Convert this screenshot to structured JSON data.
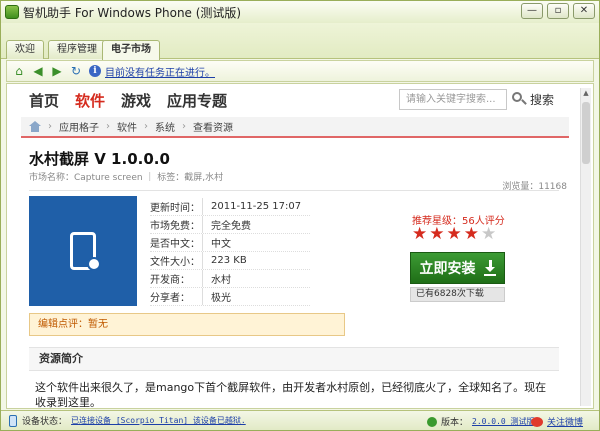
{
  "window": {
    "title": "智机助手 For Windows Phone (测试版)",
    "buttons": [
      "—",
      "▫",
      "✕"
    ]
  },
  "tabs": [
    {
      "label": "欢迎",
      "active": false
    },
    {
      "label": "程序管理",
      "active": false
    },
    {
      "label": "电子市场",
      "active": true
    }
  ],
  "toolbar": {
    "status_text": "目前没有任务正在进行。",
    "info_icon": "i"
  },
  "nav": {
    "items": [
      {
        "label": "首页",
        "active": false
      },
      {
        "label": "软件",
        "active": true
      },
      {
        "label": "游戏",
        "active": false
      },
      {
        "label": "应用专题",
        "active": false
      }
    ],
    "search_placeholder": "请输入关键字搜索...",
    "search_button": "搜索"
  },
  "breadcrumb": {
    "items": [
      "应用格子",
      "软件",
      "系统",
      "查看资源"
    ],
    "separator": "›"
  },
  "app": {
    "title": "水村截屏 V 1.0.0.0",
    "meta": "市场名称：Capture screen  ｜  标签：截屏,水村",
    "views": "浏览量：11168",
    "details": [
      {
        "label": "更新时间：",
        "value": "2011-11-25 17:07"
      },
      {
        "label": "市场免费：",
        "value": "完全免费"
      },
      {
        "label": "是否中文：",
        "value": "中文"
      },
      {
        "label": "文件大小：",
        "value": "223 KB"
      },
      {
        "label": "开发商：",
        "value": "水村"
      },
      {
        "label": "分享者：",
        "value": "极光"
      }
    ],
    "rating_text": "推荐星级：56人评分",
    "rating_stars": 4,
    "rating_max": 5,
    "star_glyph": "★",
    "install_label": "立即安装",
    "download_count": "已有6828次下载",
    "review": "编辑点评：暂无",
    "intro_title": "资源简介",
    "intro_body": "这个软件出来很久了，是mango下首个截屏软件，由开发者水村原创，已经彻底火了，全球知名了。现在收录到这里。"
  },
  "statusbar": {
    "device_label": "设备状态：",
    "device_value": "已连接设备 [Scorpio Titan] 该设备已越狱.",
    "version_label": "版本：",
    "version_value": "2.0.0.0 测试版",
    "weibo_label": "关注微博"
  },
  "colors": {
    "accent_red": "#d52b1e",
    "install_green": "#2a8a22",
    "app_tile_blue": "#1f5fa8",
    "link_blue": "#1d3fa8"
  }
}
